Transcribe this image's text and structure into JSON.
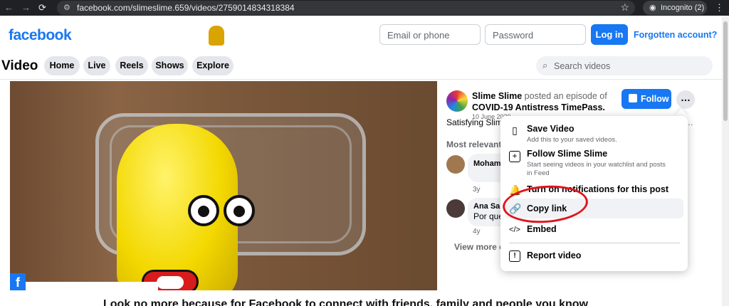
{
  "browser": {
    "url": "facebook.com/slimeslime.659/videos/2759014834318384",
    "incognito_label": "Incognito (2)"
  },
  "header": {
    "logo": "facebook",
    "email_placeholder": "Email or phone",
    "password_placeholder": "Password",
    "login_label": "Log in",
    "forgot_label": "Forgotten account?"
  },
  "video_nav": {
    "title": "Video",
    "tabs": [
      {
        "label": "Home"
      },
      {
        "label": "Live"
      },
      {
        "label": "Reels"
      },
      {
        "label": "Shows"
      },
      {
        "label": "Explore"
      }
    ],
    "search_placeholder": "Search videos"
  },
  "post": {
    "author": "Slime Slime",
    "action": "posted an episode of",
    "series": "COVID-19 Antistress TimePass.",
    "date": "10 June 2020",
    "follow_label": "Follow",
    "caption": "Satisfying Slime"
  },
  "comments": {
    "section_label": "Most relevant",
    "items": [
      {
        "name": "Mohamm",
        "text": "",
        "time": "3y"
      },
      {
        "name": "Ana Sala",
        "text": "Por que",
        "time": "4y"
      }
    ],
    "view_more": "View more co"
  },
  "menu": {
    "items": [
      {
        "label": "Save Video",
        "sub": "Add this to your saved videos."
      },
      {
        "label": "Follow Slime Slime",
        "sub": "Start seeing videos in your watchlist and posts in Feed"
      },
      {
        "label": "Turn on notifications for this post",
        "sub": ""
      },
      {
        "label": "Copy link",
        "sub": ""
      },
      {
        "label": "Embed",
        "sub": ""
      },
      {
        "label": "Report video",
        "sub": ""
      }
    ]
  },
  "bottom_caption": "Look no more because for Facebook to connect with friends, family and people you know"
}
